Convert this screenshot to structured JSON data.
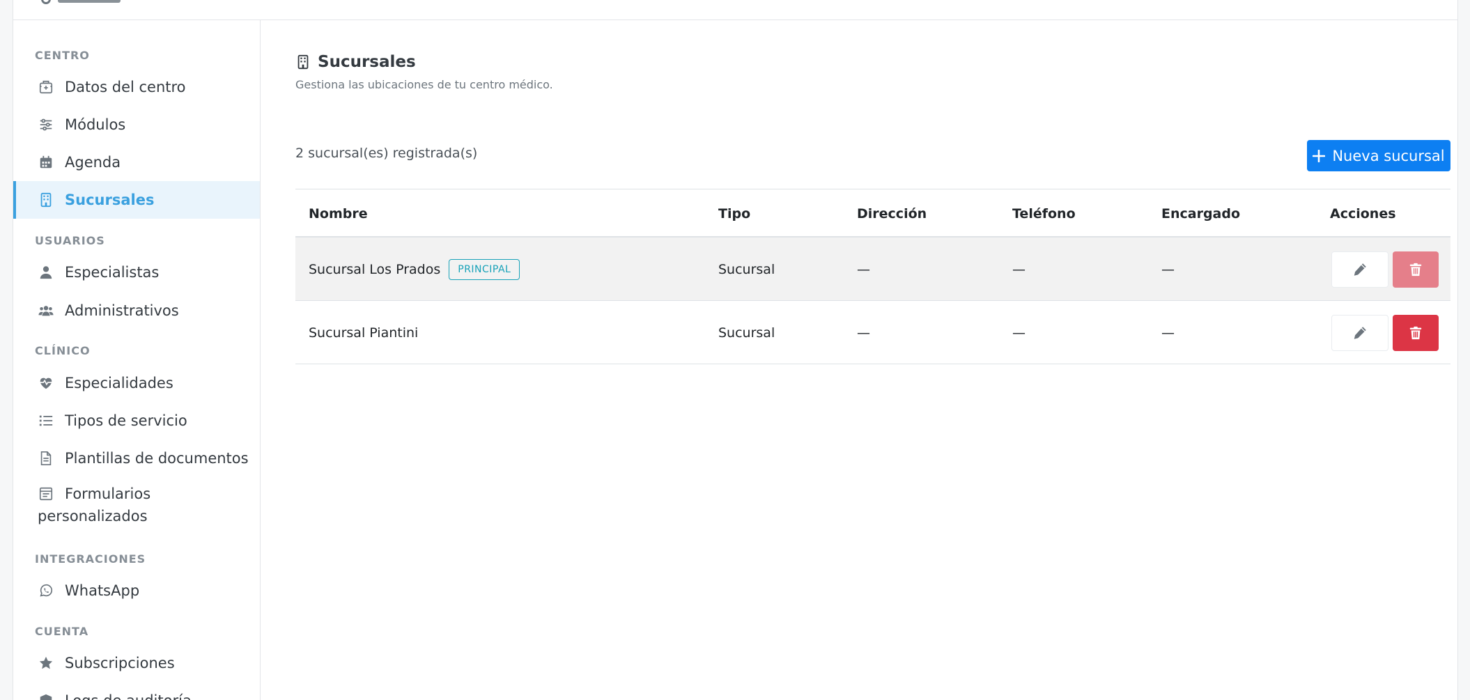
{
  "sidebar": {
    "sections": [
      {
        "label": "CENTRO"
      },
      {
        "label": "USUARIOS"
      },
      {
        "label": "CLÍNICO"
      },
      {
        "label": "INTEGRACIONES"
      },
      {
        "label": "CUENTA"
      }
    ],
    "items": [
      {
        "label": "Datos del centro",
        "icon": "building-hospital-icon"
      },
      {
        "label": "Módulos",
        "icon": "sliders-icon"
      },
      {
        "label": "Agenda",
        "icon": "calendar-icon"
      },
      {
        "label": "Sucursales",
        "icon": "building-icon",
        "active": true
      },
      {
        "label": "Especialistas",
        "icon": "user-doctor-icon"
      },
      {
        "label": "Administrativos",
        "icon": "users-icon"
      },
      {
        "label": "Especialidades",
        "icon": "heart-pulse-icon"
      },
      {
        "label": "Tipos de servicio",
        "icon": "list-icon"
      },
      {
        "label": "Plantillas de documentos",
        "icon": "file-icon"
      },
      {
        "label_line1": "Formularios",
        "label_line2": "personalizados",
        "icon": "form-icon"
      },
      {
        "label": "WhatsApp",
        "icon": "whatsapp-icon"
      },
      {
        "label": "Subscripciones",
        "icon": "star-icon"
      },
      {
        "label": "Logs de auditoría",
        "icon": "shield-icon"
      }
    ]
  },
  "page": {
    "title": "Sucursales",
    "title_icon": "building-icon",
    "subtitle": "Gestiona las ubicaciones de tu centro médico.",
    "count_text": "2 sucursal(es) registrada(s)",
    "new_button_label": "Nueva sucursal"
  },
  "table": {
    "headers": {
      "nombre": "Nombre",
      "tipo": "Tipo",
      "direccion": "Dirección",
      "telefono": "Teléfono",
      "encargado": "Encargado",
      "acciones": "Acciones"
    },
    "rows": [
      {
        "nombre": "Sucursal Los Prados",
        "badge": "PRINCIPAL",
        "tipo": "Sucursal",
        "direccion": "—",
        "telefono": "—",
        "encargado": "—"
      },
      {
        "nombre": "Sucursal Piantini",
        "badge": "",
        "tipo": "Sucursal",
        "direccion": "—",
        "telefono": "—",
        "encargado": "—"
      }
    ]
  },
  "colors": {
    "accent": "#3aa0df",
    "primary_button": "#0d7ff2",
    "danger": "#dc3545",
    "badge": "#17a2b8"
  }
}
